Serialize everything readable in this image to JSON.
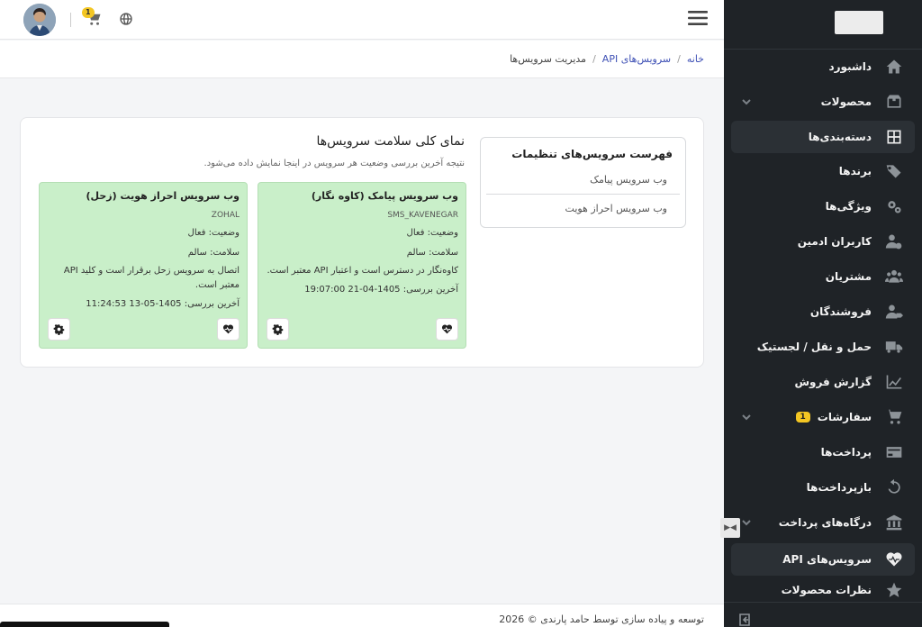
{
  "sidebar": {
    "items": [
      {
        "label": "داشبورد",
        "icon": "home-icon"
      },
      {
        "label": "محصولات",
        "icon": "box-icon",
        "expandable": true
      },
      {
        "label": "دسته‌بندی‌ها",
        "icon": "grid-icon",
        "active": true
      },
      {
        "label": "برندها",
        "icon": "tags-icon"
      },
      {
        "label": "ویژگی‌ها",
        "icon": "gears-icon"
      },
      {
        "label": "کاربران ادمین",
        "icon": "user-gear-icon"
      },
      {
        "label": "مشتریان",
        "icon": "users-icon"
      },
      {
        "label": "فروشندگان",
        "icon": "user-tag-icon"
      },
      {
        "label": "حمل و نقل / لجستیک",
        "icon": "truck-icon"
      },
      {
        "label": "گزارش فروش",
        "icon": "chart-line-icon"
      },
      {
        "label": "سفارشات",
        "icon": "cart-icon",
        "expandable": true,
        "badge": "1"
      },
      {
        "label": "پرداخت‌ها",
        "icon": "credit-card-icon"
      },
      {
        "label": "بازپرداخت‌ها",
        "icon": "undo-icon"
      },
      {
        "label": "درگاه‌های پرداخت",
        "icon": "bank-icon",
        "expandable": true
      },
      {
        "label": "سرویس‌های API",
        "icon": "heart-pulse-icon",
        "active": true
      },
      {
        "label": "نظرات محصولات",
        "icon": "star-icon"
      }
    ]
  },
  "topbar": {
    "cart_badge": "1"
  },
  "breadcrumb": {
    "home": "خانه",
    "api_services": "سرویس‌های API",
    "current": "مدیریت سرویس‌ها",
    "sep": "/"
  },
  "settings_list": {
    "title": "فهرست سرویس‌های تنظیمات",
    "items": [
      "وب سرویس پیامک",
      "وب سرویس احراز هویت"
    ]
  },
  "overview": {
    "title": "نمای کلی سلامت سرویس‌ها",
    "subtitle": "نتیجه آخرین بررسی وضعیت هر سرویس در اینجا نمایش داده می‌شود."
  },
  "services": [
    {
      "title": "وب سرویس پیامک (کاوه نگار)",
      "code": "SMS_KAVENEGAR",
      "status": "وضعیت: فعال",
      "health": "سلامت: سالم",
      "message": "کاوه‌نگار در دسترس است و اعتبار API معتبر است.",
      "last_check": "آخرین بررسی: 1405-04-21 19:07:00"
    },
    {
      "title": "وب سرویس احراز هویت (زحل)",
      "code": "ZOHAL",
      "status": "وضعیت: فعال",
      "health": "سلامت: سالم",
      "message": "اتصال به سرویس زحل برقرار است و کلید API معتبر است.",
      "last_check": "آخرین بررسی: 1405-05-13 11:24:53"
    }
  ],
  "footer": {
    "text": "توسعه و پیاده سازی توسط حامد پارندی © 2026"
  },
  "colors": {
    "sidebar_bg": "#1f2327",
    "card_green": "#c9efc9",
    "link": "#3f51b5",
    "badge": "#f3c623"
  }
}
